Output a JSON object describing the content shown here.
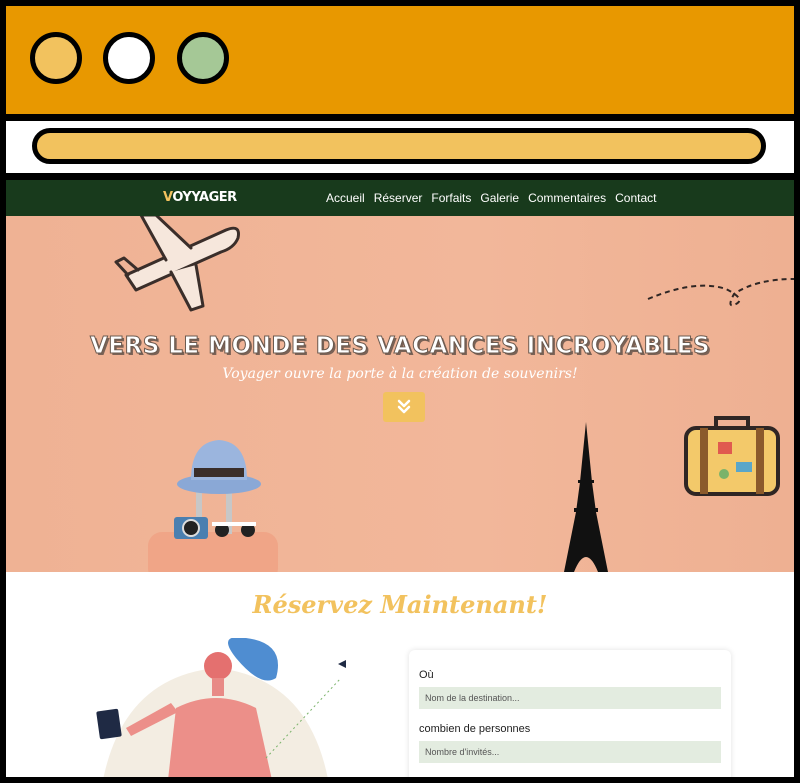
{
  "nav": {
    "logo": "OYYAGER",
    "logo_first": "V",
    "items": [
      "Accueil",
      "Réserver",
      "Forfaits",
      "Galerie",
      "Commentaires",
      "Contact"
    ]
  },
  "hero": {
    "title": "VERS LE MONDE DES VACANCES INCROYABLES",
    "subtitle": "Voyager ouvre la porte à la création de souvenirs!",
    "scroll_icon": "double-chevron-down-icon"
  },
  "booking": {
    "title": "Réservez Maintenant!",
    "where_label": "Où",
    "where_placeholder": "Nom de la destination...",
    "people_label": "combien de personnes",
    "people_placeholder": "Nombre d'invités..."
  },
  "colors": {
    "titlebar": "#e89800",
    "accent": "#f2c25e",
    "nav_bg": "#183a1c",
    "hero_bg": "#f2b79a",
    "input_bg": "#e3ece0"
  }
}
